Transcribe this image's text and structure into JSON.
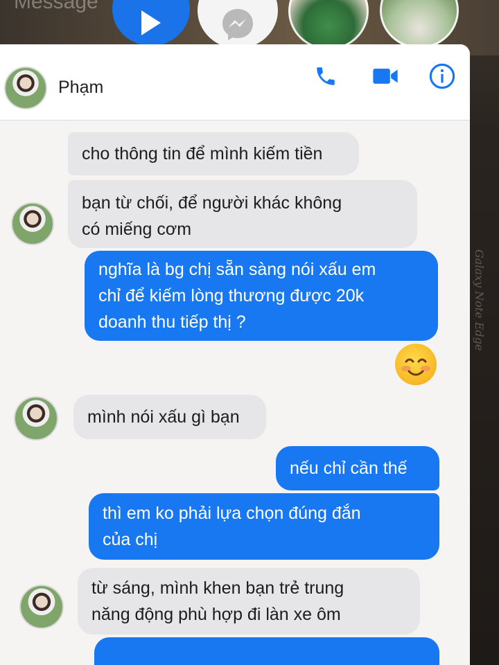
{
  "top": {
    "ghost_label": "Message"
  },
  "header": {
    "contact_name": "Phạm",
    "call_icon": "phone-icon",
    "video_icon": "video-camera-icon",
    "info_icon": "info-icon"
  },
  "messages": [
    {
      "side": "in",
      "text_lines": [
        "cho thông tin để mình kiếm tiền"
      ]
    },
    {
      "side": "in",
      "text_lines": [
        "bạn từ chối, để người khác không",
        "có miếng cơm"
      ]
    },
    {
      "side": "out",
      "text_lines": [
        "nghĩa là bg chị sẵn sàng nói xấu em",
        "chỉ để kiếm lòng thương được 20k",
        "doanh thu tiếp thị ?"
      ]
    },
    {
      "side": "in",
      "text_lines": [
        "mình nói xấu gì bạn"
      ]
    },
    {
      "side": "out",
      "text_lines": [
        "nếu chỉ cần thế"
      ]
    },
    {
      "side": "out",
      "text_lines": [
        "thì em ko phải lựa chọn đúng đắn",
        "của chị"
      ]
    },
    {
      "side": "in",
      "text_lines": [
        "từ sáng, mình khen bạn trẻ trung",
        "năng động phù hợp đi làn xe ôm"
      ]
    }
  ],
  "edge_label": "Galaxy Note Edge",
  "colors": {
    "outgoing_bubble": "#1778f2",
    "incoming_bubble": "#e6e6e8",
    "accent": "#1778f2"
  }
}
